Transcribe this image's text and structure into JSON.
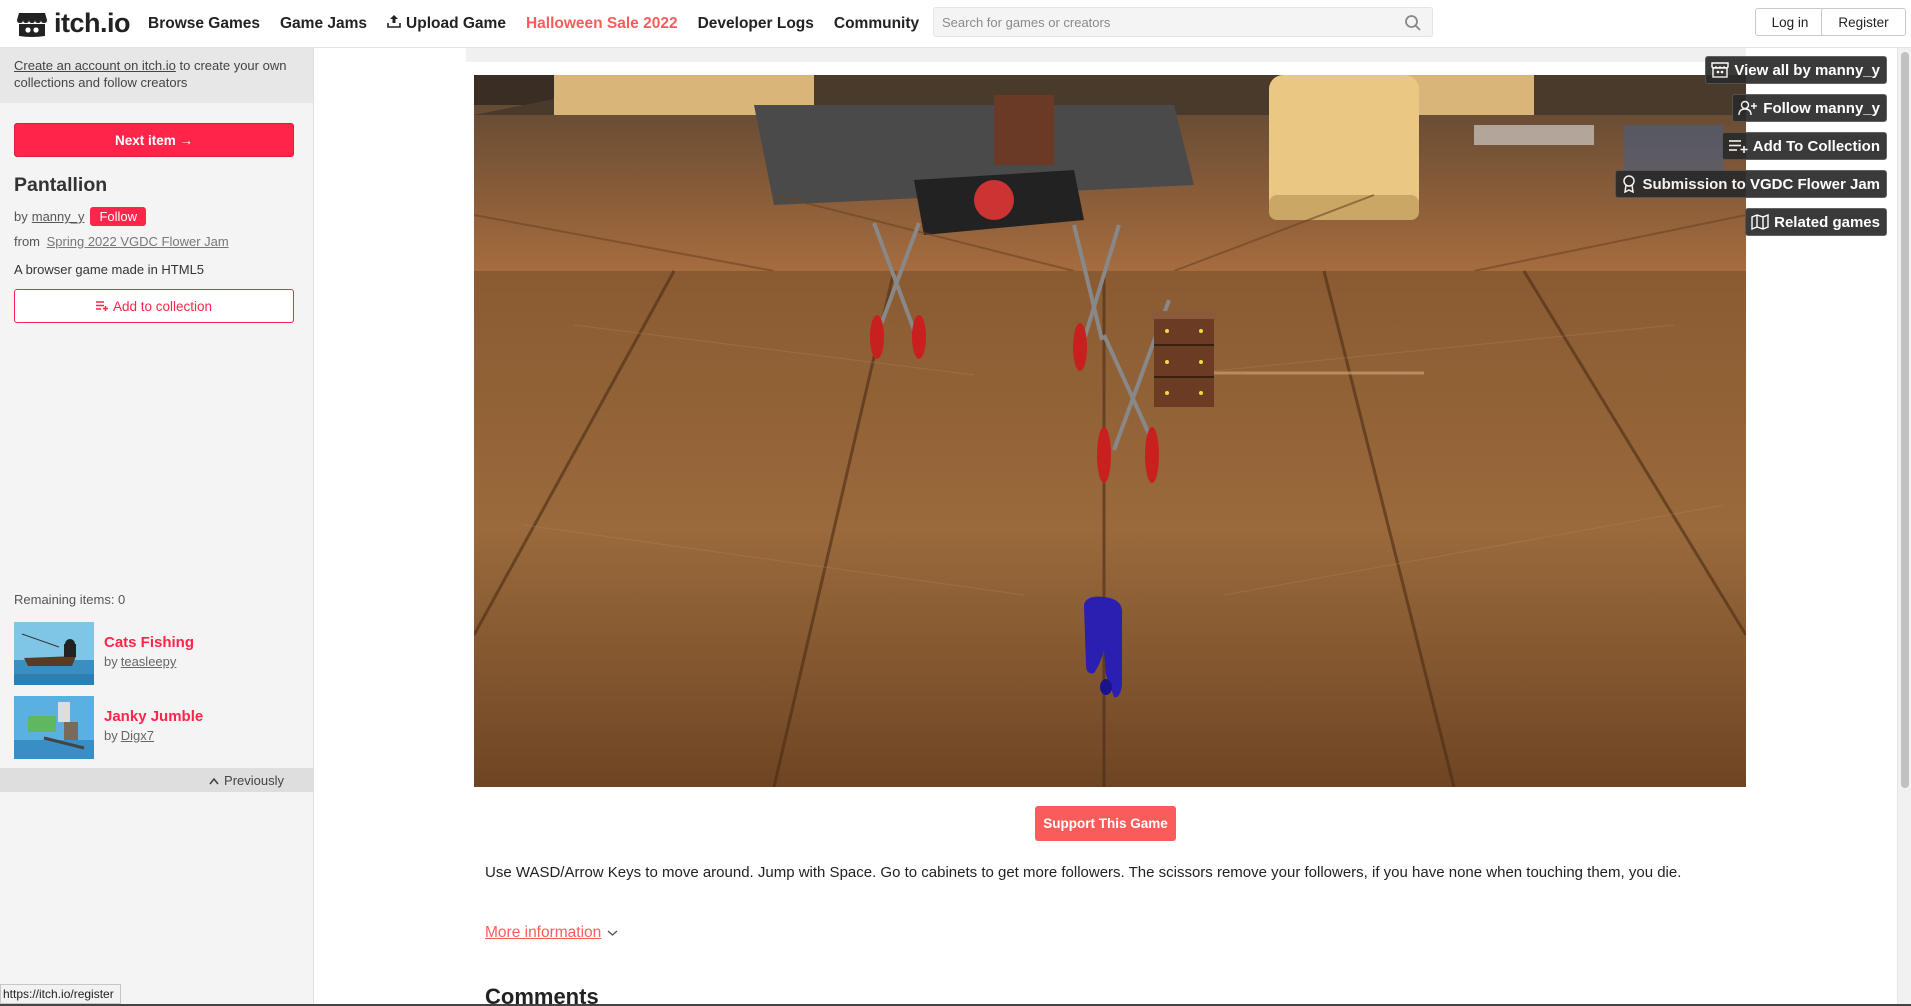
{
  "nav": {
    "logo_text": "itch.io",
    "links": [
      "Browse Games",
      "Game Jams",
      "Upload Game",
      "Halloween Sale 2022",
      "Developer Logs",
      "Community"
    ],
    "search_placeholder": "Search for games or creators",
    "login": "Log in",
    "register": "Register"
  },
  "sidebar": {
    "promo_link": "Create an account on itch.io",
    "promo_rest": " to create your own collections and follow creators",
    "next_item": "Next item →",
    "title": "Pantallion",
    "by": "by",
    "author": "manny_y",
    "follow": "Follow",
    "from": "from",
    "jam": "Spring 2022 VGDC Flower Jam",
    "description": "A browser game made in HTML5",
    "add_to_collection": "Add to collection",
    "remaining": "Remaining items: 0",
    "related": [
      {
        "title": "Cats Fishing",
        "by": "by",
        "author": "teasleepy"
      },
      {
        "title": "Janky Jumble",
        "by": "by",
        "author": "Digx7"
      }
    ],
    "previously": "Previously"
  },
  "main": {
    "support": "Support This Game",
    "instructions": "Use WASD/Arrow Keys to move around. Jump with Space. Go to cabinets to get more followers. The scissors remove your followers, if you have none when touching them, you die.",
    "more_info": "More information",
    "comments": "Comments"
  },
  "right_buttons": [
    "View all by manny_y",
    "Follow manny_y",
    "Add To Collection",
    "Submission to VGDC Flower Jam",
    "Related games"
  ],
  "status_url": "https://itch.io/register",
  "colors": {
    "accent": "#fa5c5c",
    "brand_red": "#ff2449"
  }
}
